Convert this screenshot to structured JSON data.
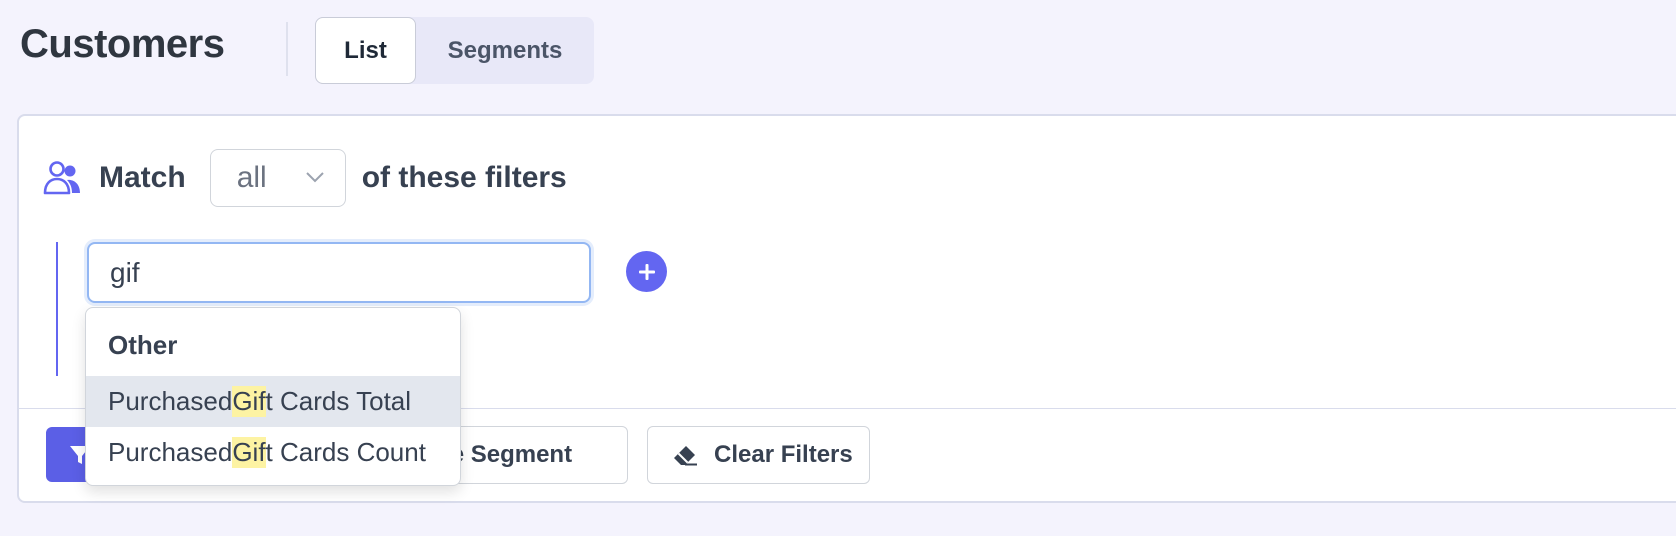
{
  "header": {
    "title": "Customers",
    "tabs": [
      {
        "label": "List",
        "active": true
      },
      {
        "label": "Segments",
        "active": false
      }
    ]
  },
  "filter": {
    "match_prefix": "Match",
    "match_value": "all",
    "match_suffix": "of these filters",
    "search_value": "gif",
    "people_icon": "people-icon",
    "add_icon": "plus-circle-icon",
    "accent_color": "#6366f1"
  },
  "dropdown": {
    "group_label": "Other",
    "highlight_color": "#fdf3a3",
    "options": [
      {
        "before": "Purchased ",
        "match": "Gif",
        "after": "t Cards Total",
        "hovered": true
      },
      {
        "before": "Purchased ",
        "match": "Gif",
        "after": "t Cards Count",
        "hovered": false
      }
    ]
  },
  "footer": {
    "apply_icon": "filter-icon",
    "save_label": "Save Segment",
    "save_visible_label": "ave Segment",
    "clear_label": "Clear Filters",
    "clear_icon": "eraser-icon"
  }
}
